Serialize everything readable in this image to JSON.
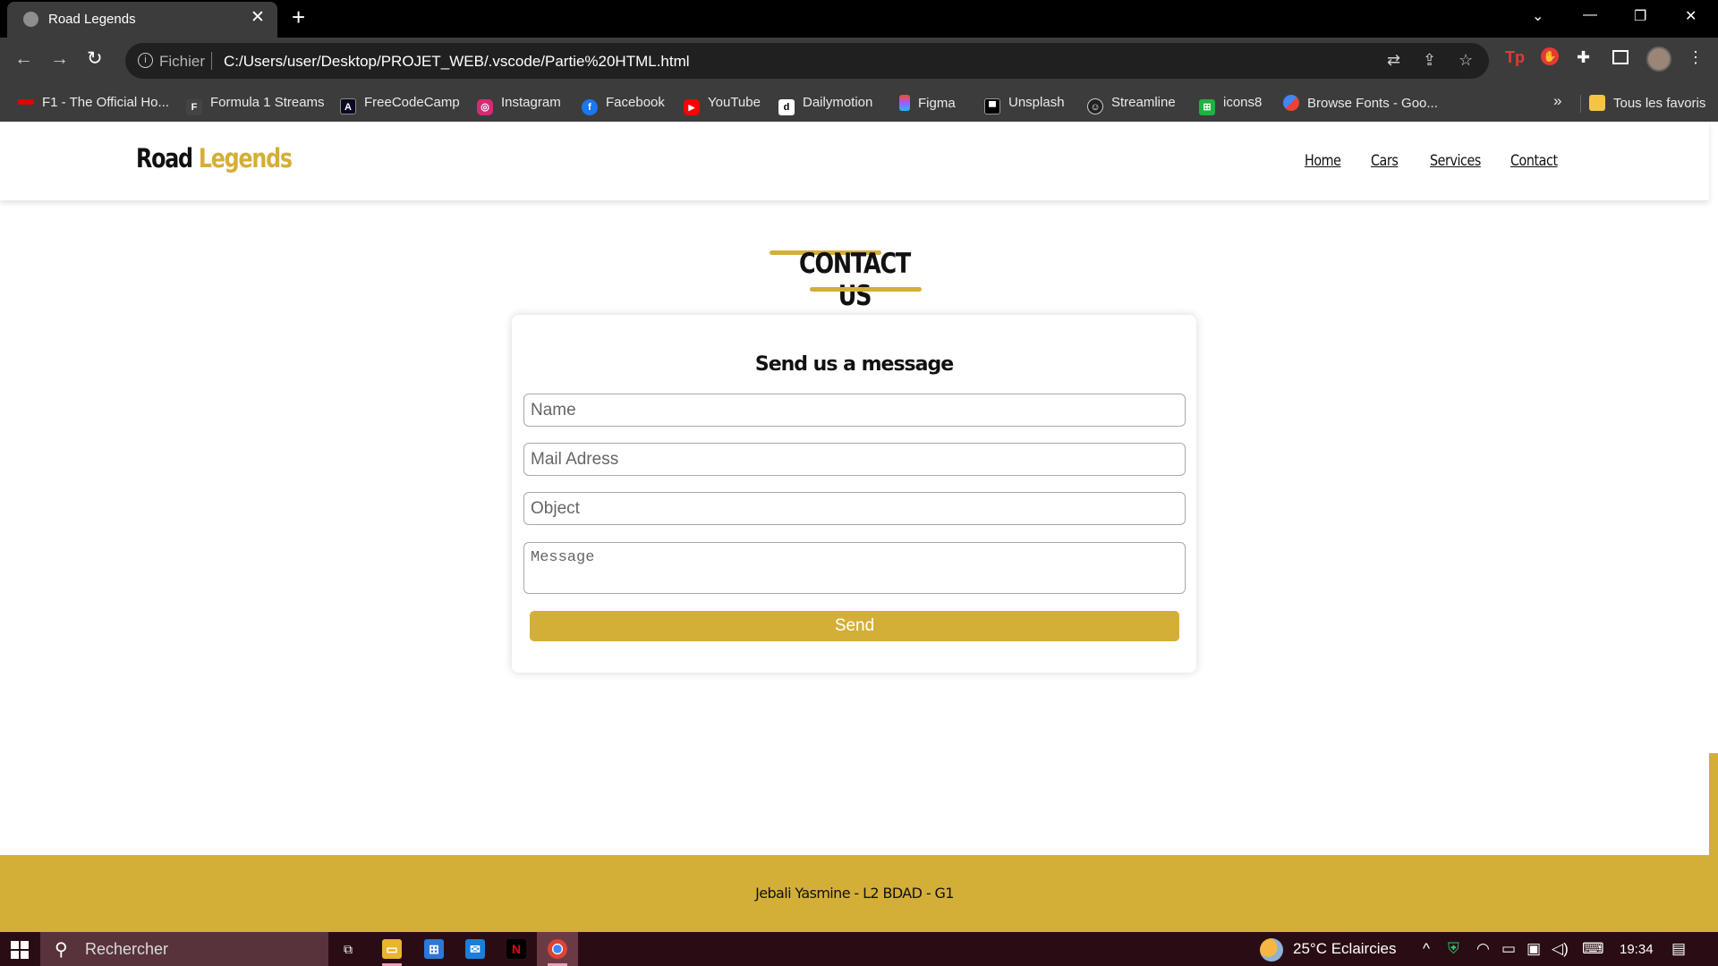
{
  "browser": {
    "tab_title": "Road Legends",
    "close_glyph": "✕",
    "new_tab_glyph": "+",
    "back_glyph": "←",
    "forward_glyph": "→",
    "reload_glyph": "↻",
    "url_scheme": "Fichier",
    "url": "C:/Users/user/Desktop/PROJET_WEB/.vscode/Partie%20HTML.html",
    "more_bookmarks": "»",
    "all_bookmarks": "Tous les favoris",
    "bookmarks": [
      {
        "label": "F1 - The Official Ho...",
        "icon": "f1-icon",
        "color": "#e10600"
      },
      {
        "label": "Formula 1 Streams",
        "icon": "formula1-streams-icon",
        "color": "#444444"
      },
      {
        "label": "FreeCodeCamp",
        "icon": "freecodecamp-icon",
        "color": "#0a0a23"
      },
      {
        "label": "Instagram",
        "icon": "instagram-icon",
        "color": "#d62976"
      },
      {
        "label": "Facebook",
        "icon": "facebook-icon",
        "color": "#1877f2"
      },
      {
        "label": "YouTube",
        "icon": "youtube-icon",
        "color": "#ff0000"
      },
      {
        "label": "Dailymotion",
        "icon": "dailymotion-icon",
        "color": "#ffffff"
      },
      {
        "label": "Figma",
        "icon": "figma-icon",
        "color": "#a259ff"
      },
      {
        "label": "Unsplash",
        "icon": "unsplash-icon",
        "color": "#000000"
      },
      {
        "label": "Streamline",
        "icon": "streamline-icon",
        "color": "#222222"
      },
      {
        "label": "icons8",
        "icon": "icons8-icon",
        "color": "#1fb141"
      },
      {
        "label": "Browse Fonts - Goo...",
        "icon": "google-fonts-icon",
        "color": "#4285f4"
      }
    ]
  },
  "site": {
    "logo_part1": "Road",
    "logo_part2": "Legends",
    "nav": [
      "Home",
      "Cars",
      "Services",
      "Contact"
    ],
    "section_title": "CONTACT US",
    "form": {
      "title": "Send us a message",
      "name_placeholder": "Name",
      "mail_placeholder": "Mail Adress",
      "object_placeholder": "Object",
      "message_placeholder": "Message",
      "send_label": "Send"
    },
    "footer_text": "Jebali Yasmine - L2 BDAD - G1",
    "accent_color": "#d4af37"
  },
  "taskbar": {
    "search_placeholder": "Rechercher",
    "weather": "25°C  Eclaircies",
    "time": "19:34",
    "tray_chevron": "^"
  }
}
